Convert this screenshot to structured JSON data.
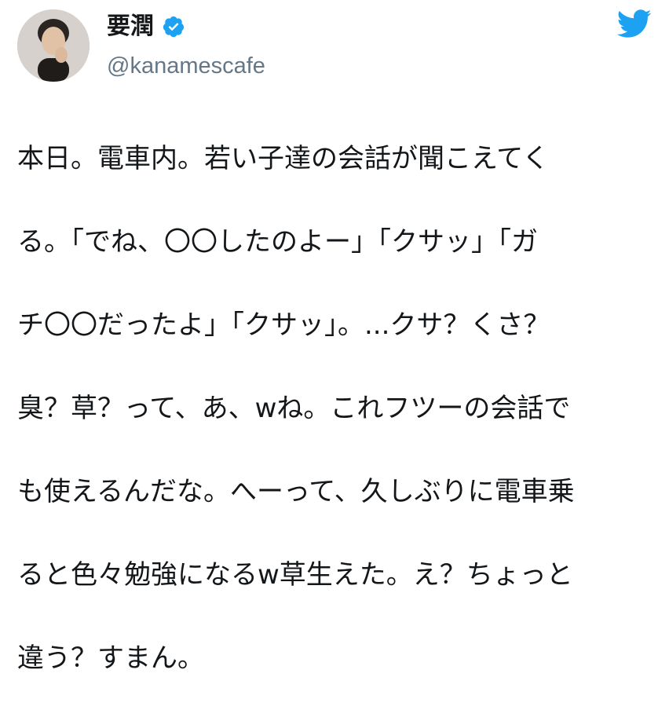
{
  "user": {
    "display_name": "要潤",
    "handle": "@kanamescafe",
    "verified": true
  },
  "icons": {
    "avatar": "profile-photo",
    "verified": "verified-badge-icon",
    "brand": "twitter-bird-icon"
  },
  "colors": {
    "verified_blue": "#1da1f2",
    "handle_gray": "#657786",
    "text": "#14171a",
    "twitter_blue": "#1da1f2"
  },
  "tweet": {
    "lines": [
      "本日。電車内。若い子達の会話が聞こえてく",
      "る。「でね、〇〇したのよー」「クサッ」「ガ",
      "チ〇〇だったよ」「クサッ」。...クサ？くさ？",
      "臭？草？って、あ、wね。これフツーの会話で",
      "も使えるんだな。へーって、久しぶりに電車乗",
      "ると色々勉強になるw草生えた。え？ちょっと",
      "違う？すまん。"
    ]
  }
}
